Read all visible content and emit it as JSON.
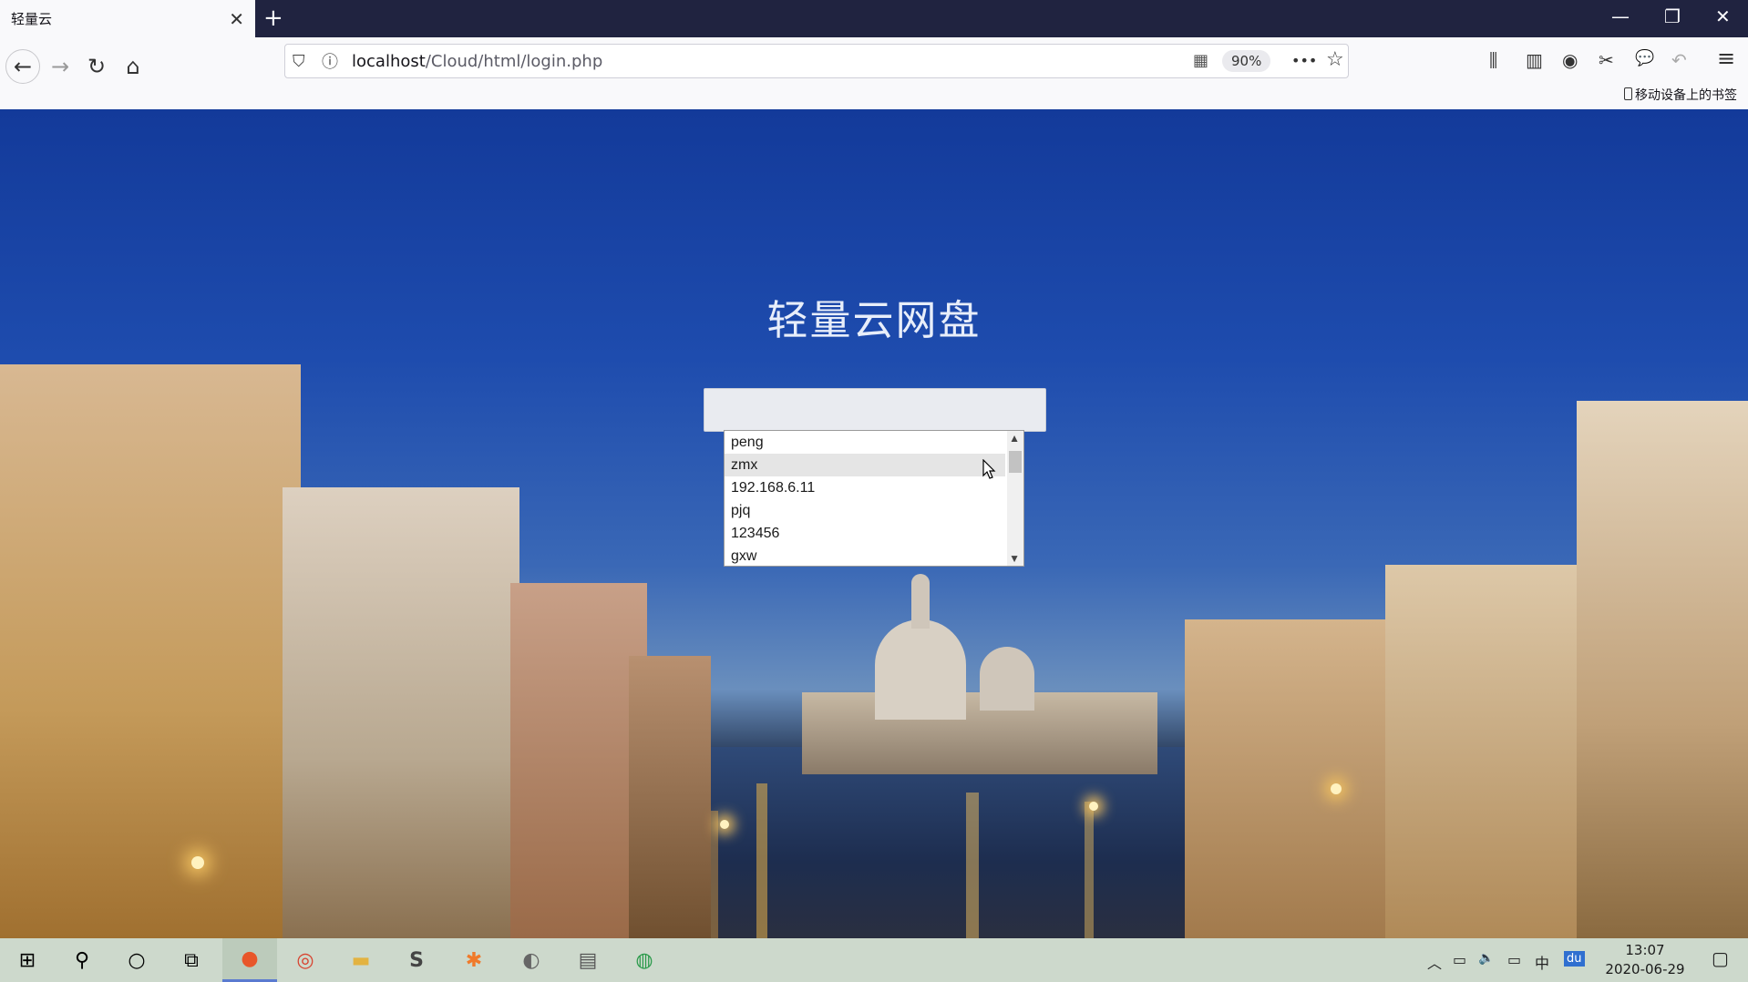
{
  "browser": {
    "tab_title": "轻量云",
    "tab_close": "✕",
    "new_tab": "+",
    "url_host": "localhost",
    "url_path": "/Cloud/html/login.php",
    "zoom": "90%",
    "mobile_bookmarks": "移动设备上的书签",
    "window_controls": {
      "minimize": "—",
      "restore": "❐",
      "close": "✕"
    },
    "nav": {
      "back": "←",
      "forward": "→",
      "reload": "↻",
      "home": "⌂"
    },
    "toolbar_icons": {
      "more": "•••",
      "star": "☆",
      "library": "⫼",
      "sidebar": "▥",
      "account": "◉",
      "screenshot": "✂",
      "chat": "💬",
      "undo": "↶",
      "menu": "≡",
      "qr": "▦",
      "shield": "⛉",
      "info": "ⓘ"
    }
  },
  "page": {
    "title": "轻量云网盘",
    "autocomplete": {
      "items": [
        "peng",
        "zmx",
        "192.168.6.11",
        "pjq",
        "123456",
        "gxw"
      ],
      "hovered_index": 1,
      "scroll_up": "▲",
      "scroll_down": "▼"
    }
  },
  "taskbar": {
    "time": "13:07",
    "date": "2020-06-29",
    "icons": {
      "start": "⊞",
      "search": "⚲",
      "cortana": "○",
      "taskview": "⧉",
      "firefox": "●",
      "chrome": "◎",
      "explorer": "▬",
      "sublime": "S",
      "app5": "✱",
      "app6": "◐",
      "app7": "▤",
      "app8": "◍",
      "tray_up": "︿",
      "network": "▭",
      "volume": "🔈",
      "display": "▭",
      "ime": "中",
      "baidu": "du",
      "notifications": "▢"
    }
  },
  "colors": {
    "accent": "#5a7ad0",
    "tabstrip": "#202340"
  }
}
